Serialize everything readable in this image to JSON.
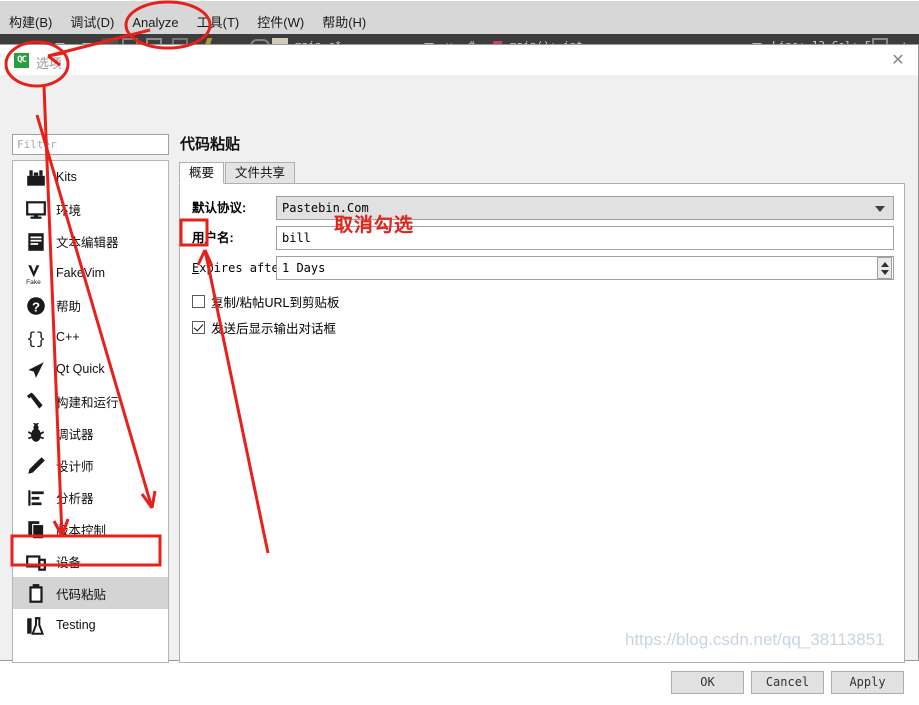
{
  "app": {
    "menubar": [
      "构建(B)",
      "调试(D)",
      "Analyze",
      "工具(T)",
      "控件(W)",
      "帮助(H)"
    ],
    "toolbar": {
      "file_label": "main.c*",
      "hash": "#",
      "symbol_label": "main(): int",
      "position_label": "Line: 13  Col: 5"
    }
  },
  "dialog": {
    "icon_text": "QC",
    "title": "选项",
    "close_icon": "✕",
    "filter": {
      "placeholder": "Filter",
      "value": ""
    },
    "sidebar": {
      "items": [
        {
          "label": "Kits",
          "icon": "kits-icon",
          "selected": false
        },
        {
          "label": "环境",
          "icon": "monitor-icon",
          "selected": false
        },
        {
          "label": "文本编辑器",
          "icon": "text-editor-icon",
          "selected": false
        },
        {
          "label": "FakeVim",
          "icon": "fakevim-icon",
          "selected": false
        },
        {
          "label": "帮助",
          "icon": "help-question-icon",
          "selected": false
        },
        {
          "label": "C++",
          "icon": "braces-icon",
          "selected": false
        },
        {
          "label": "Qt Quick",
          "icon": "qtquick-arrow-icon",
          "selected": false
        },
        {
          "label": "构建和运行",
          "icon": "hammer-icon",
          "selected": false
        },
        {
          "label": "调试器",
          "icon": "bug-icon",
          "selected": false
        },
        {
          "label": "设计师",
          "icon": "pen-icon",
          "selected": false
        },
        {
          "label": "分析器",
          "icon": "analyzer-chart-icon",
          "selected": false
        },
        {
          "label": "版本控制",
          "icon": "version-control-icon",
          "selected": false
        },
        {
          "label": "设备",
          "icon": "device-icon",
          "selected": false
        },
        {
          "label": "代码粘贴",
          "icon": "clipboard-icon",
          "selected": true
        },
        {
          "label": "Testing",
          "icon": "testing-flask-icon",
          "selected": false
        }
      ]
    },
    "panel": {
      "title": "代码粘贴",
      "tabs": [
        {
          "label": "概要",
          "active": true
        },
        {
          "label": "文件共享",
          "active": false
        }
      ],
      "fields": {
        "protocol": {
          "label": "默认协议:",
          "value": "Pastebin.Com",
          "options": [
            "Pastebin.Com"
          ]
        },
        "username": {
          "label": "用户名:",
          "value": "bill",
          "placeholder": ""
        },
        "expires": {
          "label": "Expires after:",
          "value": "1 Days"
        }
      },
      "checkboxes": [
        {
          "label": "复制/粘帖URL到剪贴板",
          "checked": false
        },
        {
          "label": "发送后显示输出对话框",
          "checked": true
        }
      ]
    },
    "buttons": [
      {
        "label": "OK"
      },
      {
        "label": "Cancel"
      },
      {
        "label": "Apply"
      }
    ]
  },
  "annotations": [
    {
      "text": "取消勾选"
    }
  ],
  "watermark": {
    "text": "https://blog.csdn.net/qq_38113851"
  },
  "colors": {
    "annotation_red": "#e8201a",
    "selected_row": "#d4d4d4",
    "toolbar_bg": "#3d3d3d",
    "dialog_bg": "#f0f0f0"
  }
}
